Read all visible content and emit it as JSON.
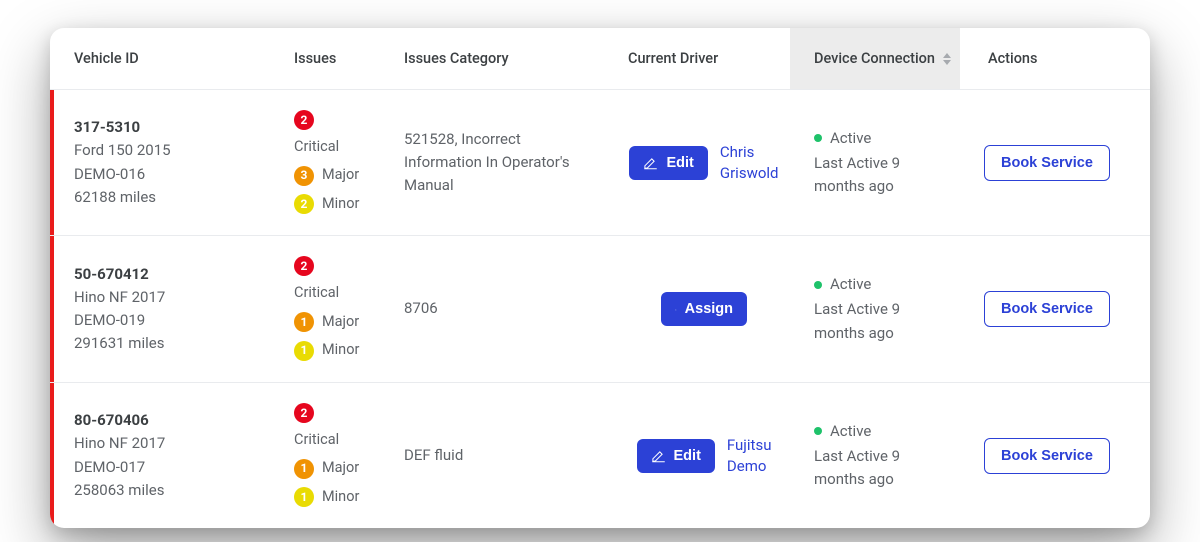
{
  "columns": {
    "vehicle_id": "Vehicle ID",
    "issues": "Issues",
    "issues_category": "Issues Category",
    "current_driver": "Current Driver",
    "device_connection": "Device Connection",
    "actions": "Actions"
  },
  "issue_labels": {
    "critical": "Critical",
    "major": "Major",
    "minor": "Minor"
  },
  "buttons": {
    "edit": "Edit",
    "assign": "Assign",
    "book_service": "Book Service"
  },
  "rows": [
    {
      "vehicle_id": "317-5310",
      "model": "Ford 150 2015",
      "demo": "DEMO-016",
      "mileage": "62188 miles",
      "issues": {
        "critical": "2",
        "major": "3",
        "minor": "2"
      },
      "category": "521528, Incorrect Information In Operator's Manual",
      "driver_action": "edit",
      "driver_name_line1": "Chris",
      "driver_name_line2": "Griswold",
      "connection": {
        "status": "Active",
        "last_active": "Last Active 9 months ago"
      }
    },
    {
      "vehicle_id": "50-670412",
      "model": "Hino NF 2017",
      "demo": "DEMO-019",
      "mileage": "291631 miles",
      "issues": {
        "critical": "2",
        "major": "1",
        "minor": "1"
      },
      "category": "8706",
      "driver_action": "assign",
      "driver_name_line1": "",
      "driver_name_line2": "",
      "connection": {
        "status": "Active",
        "last_active": "Last Active 9 months ago"
      }
    },
    {
      "vehicle_id": "80-670406",
      "model": "Hino NF 2017",
      "demo": "DEMO-017",
      "mileage": "258063 miles",
      "issues": {
        "critical": "2",
        "major": "1",
        "minor": "1"
      },
      "category": "DEF fluid",
      "driver_action": "edit",
      "driver_name_line1": "Fujitsu",
      "driver_name_line2": "Demo",
      "connection": {
        "status": "Active",
        "last_active": "Last Active 9 months ago"
      }
    }
  ]
}
